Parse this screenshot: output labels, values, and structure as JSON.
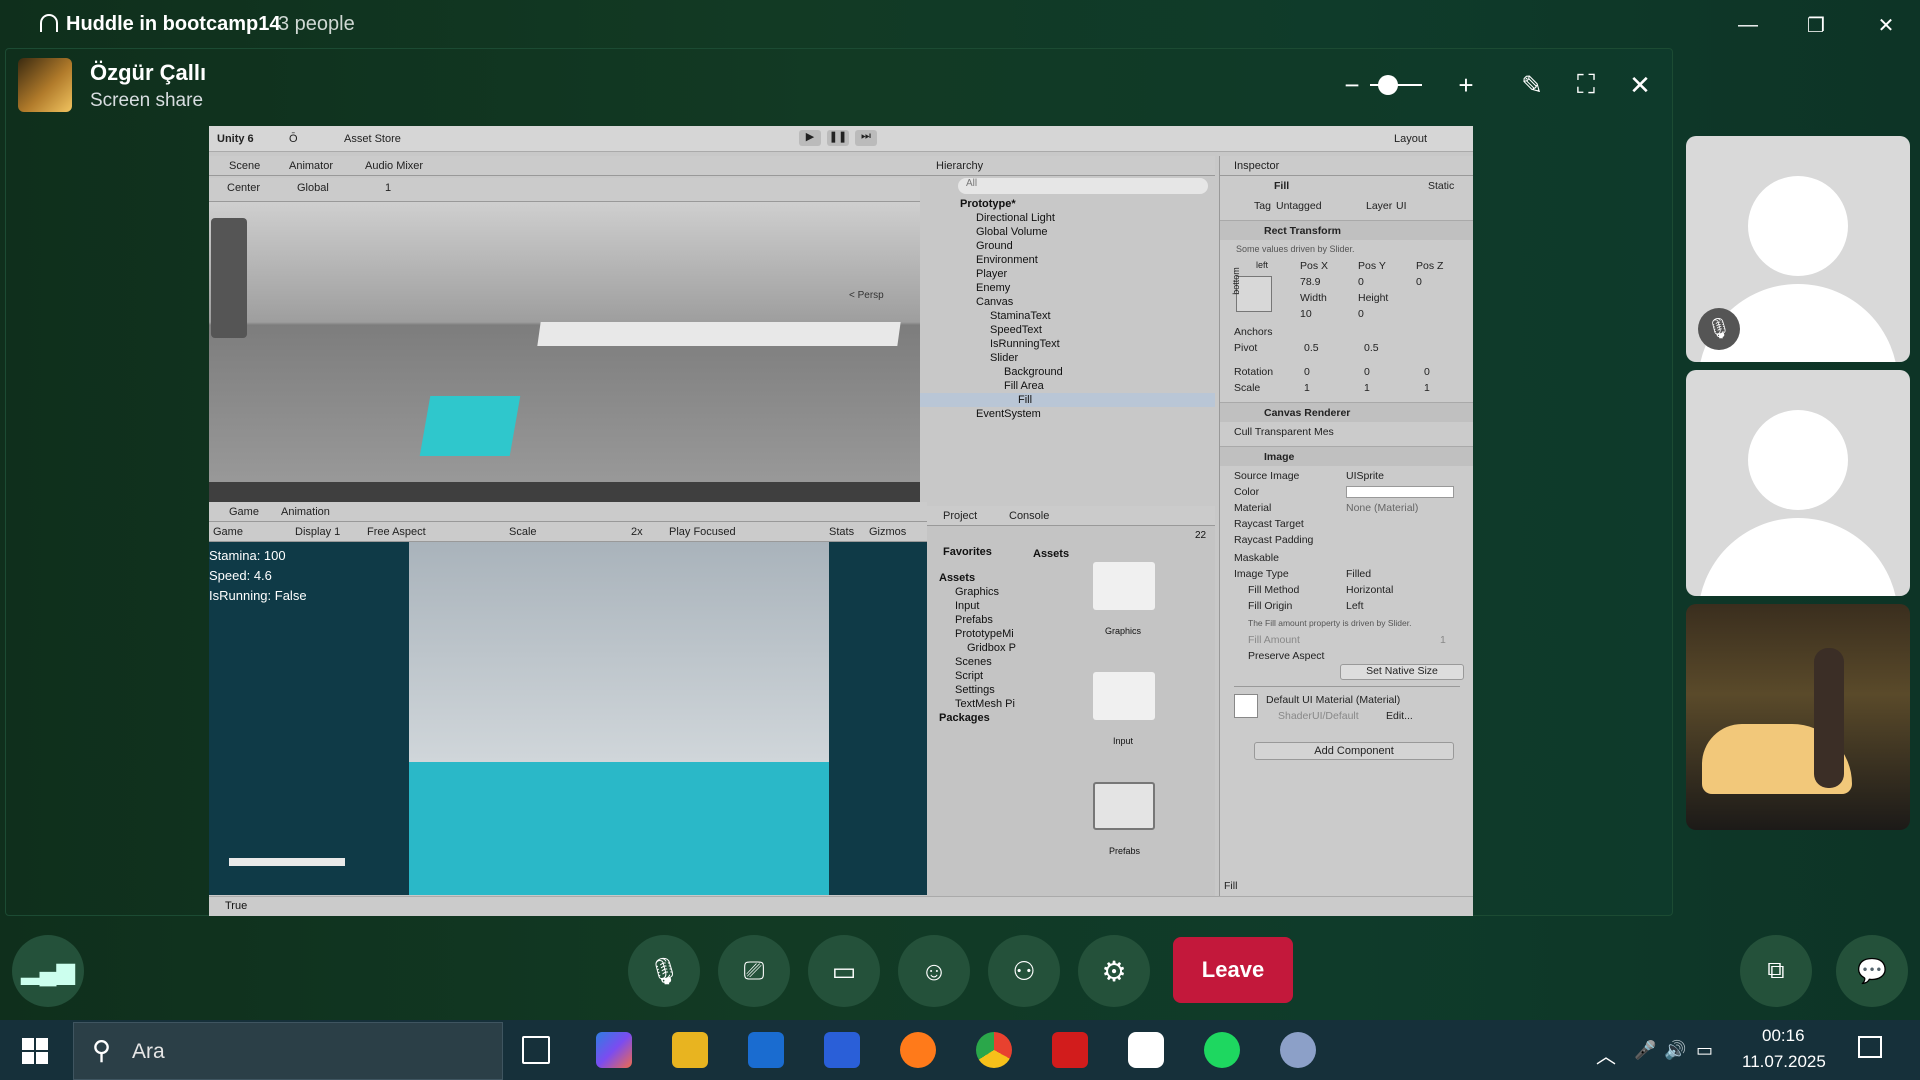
{
  "window": {
    "title": "Huddle in bootcamp14",
    "people": "3 people"
  },
  "presenter": {
    "name": "Özgür Çallı",
    "subtitle": "Screen share"
  },
  "unity": {
    "app_name": "Unity 6",
    "toolbar": {
      "account": "Ō",
      "asset_store": "Asset Store",
      "layout": "Layout"
    },
    "scene_tabs": [
      "Scene",
      "Animator",
      "Audio Mixer"
    ],
    "scene_toolbar": {
      "pivot": "Center",
      "space": "Global",
      "grid": "1"
    },
    "persp_label": "< Persp",
    "hierarchy": {
      "title": "Hierarchy",
      "search": "All",
      "items": [
        "Prototype*",
        "Directional Light",
        "Global Volume",
        "Ground",
        "Environment",
        "Player",
        "Enemy",
        "Canvas",
        "StaminaText",
        "SpeedText",
        "IsRunningText",
        "Slider",
        "Background",
        "Fill Area",
        "Fill",
        "EventSystem"
      ]
    },
    "game_tabs": [
      "Game",
      "Animation"
    ],
    "game_toolbar": {
      "mode": "Game",
      "display": "Display 1",
      "aspect": "Free Aspect",
      "scale_label": "Scale",
      "scale_value": "2x",
      "play_focused": "Play Focused",
      "stats": "Stats",
      "gizmos": "Gizmos"
    },
    "hud": {
      "stamina": "Stamina: 100",
      "speed": "Speed: 4.6",
      "running": "IsRunning: False"
    },
    "project": {
      "tabs": [
        "Project",
        "Console"
      ],
      "count": "22",
      "favorites": "Favorites",
      "assets_header": "Assets",
      "tree": [
        "Assets",
        "Graphics",
        "Input",
        "Prefabs",
        "PrototypeMi",
        "Gridbox P",
        "Scenes",
        "Script",
        "Settings",
        "TextMesh Pi",
        "Packages"
      ],
      "folders": [
        "Graphics",
        "Input",
        "Prefabs"
      ]
    },
    "status_text": "True",
    "inspector": {
      "title": "Inspector",
      "object_name": "Fill",
      "static": "Static",
      "tag_label": "Tag",
      "tag": "Untagged",
      "layer_label": "Layer",
      "layer": "UI",
      "rect": {
        "title": "Rect Transform",
        "note": "Some values driven by Slider.",
        "anchor_h": "left",
        "anchor_v": "bottom",
        "pos_x_label": "Pos X",
        "pos_y_label": "Pos Y",
        "pos_z_label": "Pos Z",
        "pos_x": "78.9",
        "pos_y": "0",
        "pos_z": "0",
        "width_label": "Width",
        "height_label": "Height",
        "width": "10",
        "height": "0",
        "anchors": "Anchors",
        "pivot_label": "Pivot",
        "pivot_x": "0.5",
        "pivot_y": "0.5",
        "rotation_label": "Rotation",
        "rot_x": "0",
        "rot_y": "0",
        "rot_z": "0",
        "scale_label": "Scale",
        "scale_x": "1",
        "scale_y": "1",
        "scale_z": "1"
      },
      "canvas_renderer": {
        "title": "Canvas Renderer",
        "cull": "Cull Transparent Mes"
      },
      "image": {
        "title": "Image",
        "source_label": "Source Image",
        "source": "UISprite",
        "color_label": "Color",
        "material_label": "Material",
        "material": "None (Material)",
        "raycast_target": "Raycast Target",
        "raycast_padding": "Raycast Padding",
        "maskable": "Maskable",
        "image_type_label": "Image Type",
        "image_type": "Filled",
        "fill_method_label": "Fill Method",
        "fill_method": "Horizontal",
        "fill_origin_label": "Fill Origin",
        "fill_origin": "Left",
        "fill_note": "The Fill amount property is driven by Slider.",
        "fill_amount_label": "Fill Amount",
        "fill_amount": "1",
        "preserve": "Preserve Aspect",
        "native": "Set Native Size"
      },
      "material": {
        "title": "Default UI Material (Material)",
        "shader_label": "Shader",
        "shader": "UI/Default",
        "edit": "Edit..."
      },
      "add_component": "Add Component",
      "footer": "Fill"
    }
  },
  "controls": {
    "leave": "Leave"
  },
  "taskbar": {
    "search": "Ara",
    "time": "00:16",
    "date": "11.07.2025"
  }
}
